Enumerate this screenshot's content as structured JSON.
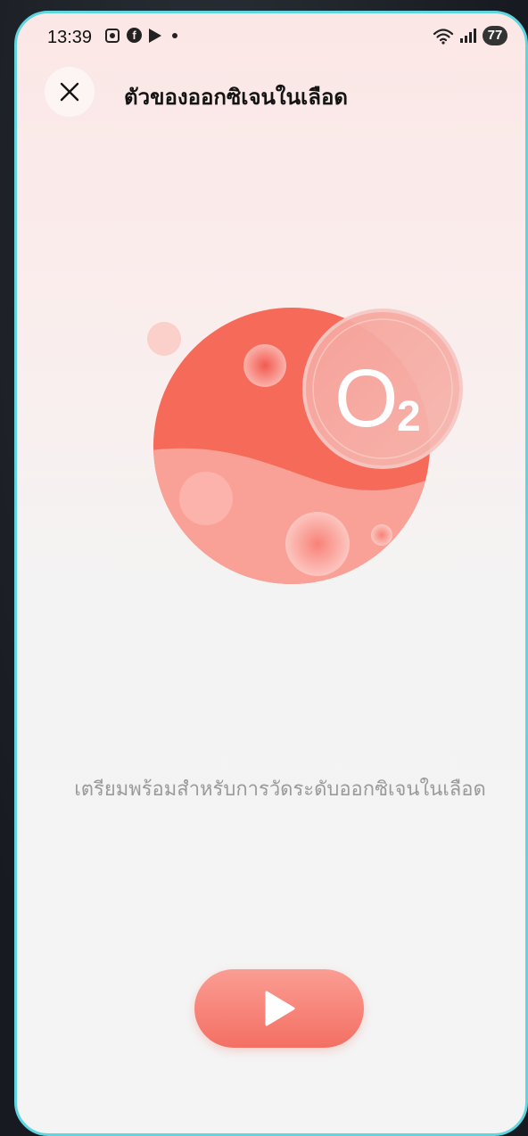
{
  "status_bar": {
    "time": "13:39",
    "battery": "77",
    "icons": [
      "screenshot-icon",
      "facebook-icon",
      "play-store-icon",
      "notification-dot-icon",
      "wifi-icon",
      "signal-icon",
      "battery-icon"
    ]
  },
  "header": {
    "title": "ตัวของออกซิเจนในเลือด",
    "close_icon": "close-icon"
  },
  "illustration": {
    "label": "O",
    "subscript": "2"
  },
  "main": {
    "prompt": "เตรียมพร้อมสำหรับการวัดระดับออกซิเจนในเลือด"
  },
  "start_button": {
    "icon": "play-icon"
  },
  "colors": {
    "accent": "#f46f63",
    "accent_light": "#fb9d93",
    "frame": "#5fd6df",
    "text_muted": "#9a9a9a"
  }
}
